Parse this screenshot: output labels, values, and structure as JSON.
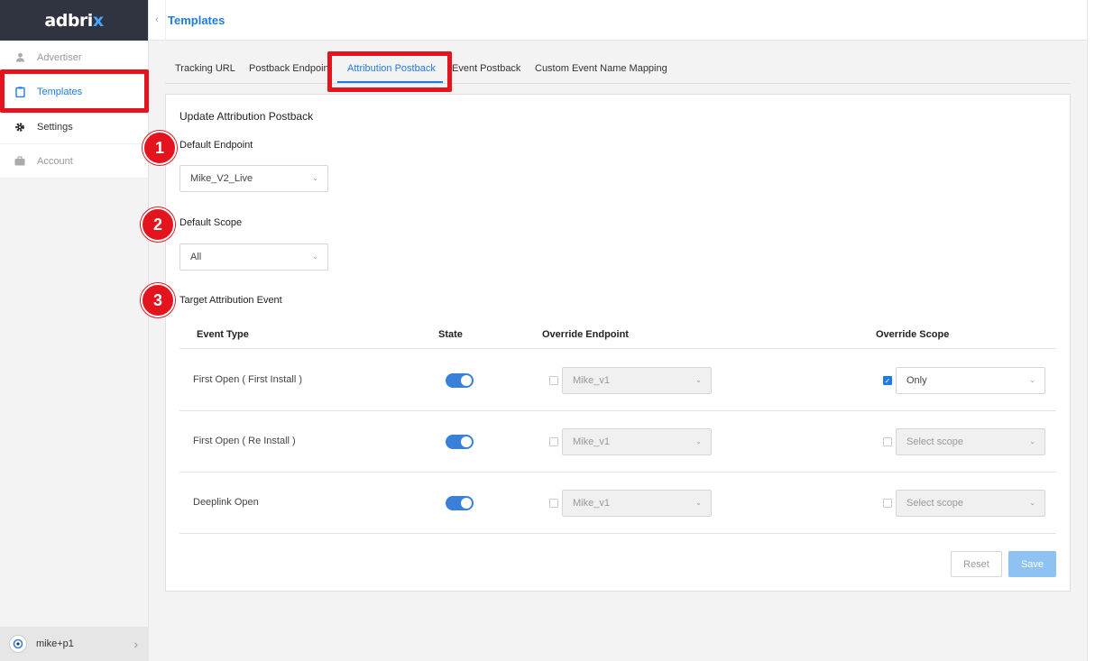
{
  "app": {
    "logo_main": "adbri",
    "logo_accent": "x"
  },
  "sidebar": {
    "items": [
      {
        "label": "Advertiser",
        "icon": "user-icon"
      },
      {
        "label": "Templates",
        "icon": "clipboard-icon"
      },
      {
        "label": "Settings",
        "icon": "gear-icon"
      },
      {
        "label": "Account",
        "icon": "briefcase-icon"
      }
    ],
    "user": "mike+p1"
  },
  "header": {
    "title": "Templates",
    "collapse_glyph": "‹"
  },
  "tabs": [
    "Tracking URL",
    "Postback Endpoint",
    "Attribution Postback",
    "Event Postback",
    "Custom Event Name Mapping"
  ],
  "form": {
    "title": "Update Attribution Postback",
    "default_endpoint": {
      "label": "Default Endpoint",
      "value": "Mike_V2_Live"
    },
    "default_scope": {
      "label": "Default Scope",
      "value": "All"
    },
    "target_label": "Target Attribution Event",
    "columns": [
      "Event Type",
      "State",
      "Override Endpoint",
      "Override Scope"
    ],
    "rows": [
      {
        "event": "First Open ( First Install )",
        "state_on": true,
        "endpoint": "Mike_v1",
        "scope_checked": true,
        "scope": "Only"
      },
      {
        "event": "First Open ( Re Install )",
        "state_on": true,
        "endpoint": "Mike_v1",
        "scope_checked": false,
        "scope": "Select scope"
      },
      {
        "event": "Deeplink Open",
        "state_on": true,
        "endpoint": "Mike_v1",
        "scope_checked": false,
        "scope": "Select scope"
      }
    ],
    "reset_label": "Reset",
    "save_label": "Save"
  },
  "annotations": [
    "1",
    "2",
    "3"
  ],
  "colors": {
    "accent": "#1e7be6",
    "highlight": "#e3141e",
    "toggle_on": "#3a7fd8"
  }
}
